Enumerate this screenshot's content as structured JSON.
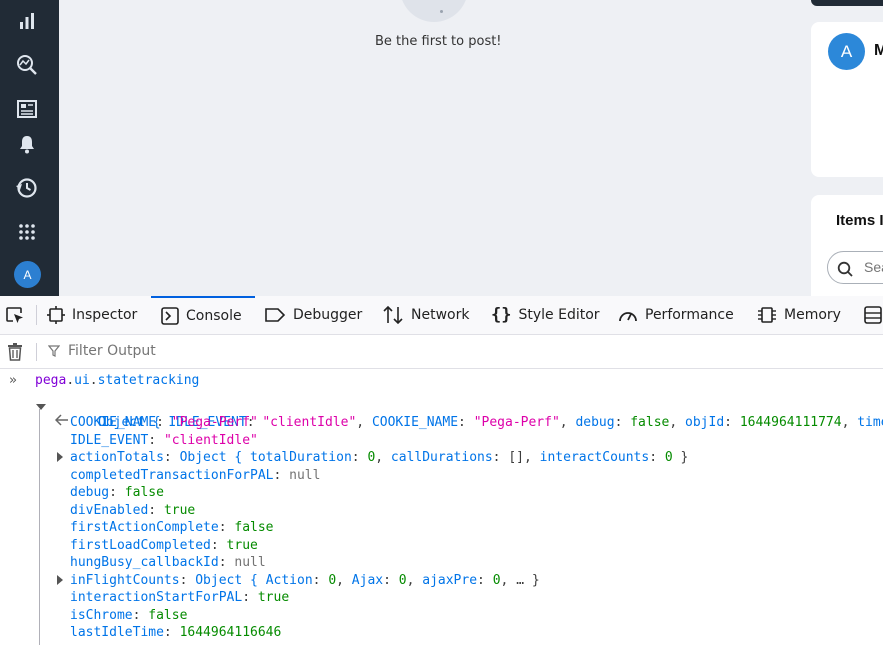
{
  "app": {
    "empty_text": "Be the first to post!",
    "profile_initial": "A",
    "profile_name": "M",
    "items_title": "Items I",
    "search_placeholder": "Sea",
    "nav_avatar_initial": "A"
  },
  "devtools": {
    "tabs": [
      "Inspector",
      "Console",
      "Debugger",
      "Network",
      "Style Editor",
      "Performance",
      "Memory"
    ],
    "filter_placeholder": "Filter Output",
    "input_expression": "pega.ui.statetracking",
    "summary": {
      "prefix": "Object { ",
      "idle_key": "IDLE_EVENT",
      "idle_val": "\"clientIdle\"",
      "cookie_key": "COOKIE_NAME",
      "cookie_val": "\"Pega-Perf\"",
      "debug_key": "debug",
      "debug_val": "false",
      "objid_key": "objId",
      "objid_val": "1644964111774",
      "time_key": "timeEna"
    },
    "props": [
      {
        "key": "COOKIE_NAME",
        "value": "\"Pega-Perf\"",
        "type": "string"
      },
      {
        "key": "IDLE_EVENT",
        "value": "\"clientIdle\"",
        "type": "string"
      },
      {
        "key": "actionTotals",
        "value": "Object { totalDuration: 0, callDurations: [], interactCounts: 0 }",
        "type": "object"
      },
      {
        "key": "completedTransactionForPAL",
        "value": "null",
        "type": "null"
      },
      {
        "key": "debug",
        "value": "false",
        "type": "bool"
      },
      {
        "key": "divEnabled",
        "value": "true",
        "type": "bool"
      },
      {
        "key": "firstActionComplete",
        "value": "false",
        "type": "bool"
      },
      {
        "key": "firstLoadCompleted",
        "value": "true",
        "type": "bool"
      },
      {
        "key": "hungBusy_callbackId",
        "value": "null",
        "type": "null"
      },
      {
        "key": "inFlightCounts",
        "value": "Object { Action: 0, Ajax: 0, ajaxPre: 0, … }",
        "type": "object"
      },
      {
        "key": "interactionStartForPAL",
        "value": "true",
        "type": "bool"
      },
      {
        "key": "isChrome",
        "value": "false",
        "type": "bool"
      },
      {
        "key": "lastIdleTime",
        "value": "1644964116646",
        "type": "number"
      }
    ]
  }
}
